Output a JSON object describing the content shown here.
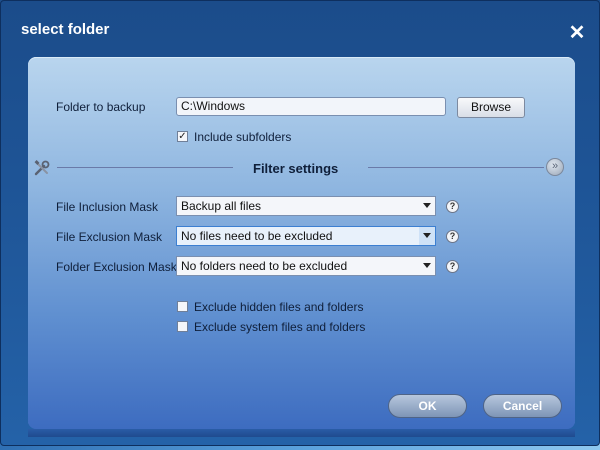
{
  "window": {
    "title": "select folder",
    "close_glyph": "✕"
  },
  "source": {
    "folder_label": "Folder to backup",
    "folder_value": "C:\\Windows",
    "browse_label": "Browse",
    "include_subfolders_label": "Include subfolders",
    "include_subfolders_checked": true
  },
  "filter": {
    "section_title": "Filter settings",
    "inclusion_label": "File Inclusion Mask",
    "inclusion_value": "Backup all files",
    "exclusion_label": "File Exclusion Mask",
    "exclusion_value": "No files need to be excluded",
    "folder_exclusion_label": "Folder Exclusion Mask",
    "folder_exclusion_value": "No folders need to be excluded",
    "help_glyph": "?",
    "exclude_hidden_label": "Exclude hidden files and folders",
    "exclude_hidden_checked": false,
    "exclude_system_label": "Exclude system files and folders",
    "exclude_system_checked": false
  },
  "footer": {
    "ok_label": "OK",
    "cancel_label": "Cancel"
  },
  "icons": {
    "tools": "tools-icon",
    "collapse": "chevron-double-down-icon",
    "close": "close-icon"
  },
  "colors": {
    "title_bar": "#1b4c8a",
    "panel_top": "#b9d5ee",
    "panel_bottom": "#3d6cc0"
  }
}
